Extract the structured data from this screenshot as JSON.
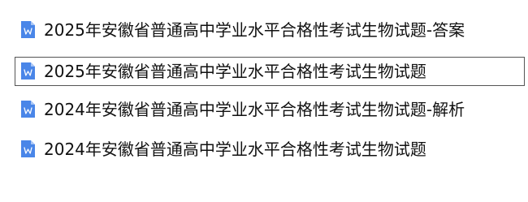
{
  "files": [
    {
      "name": "2025年安徽省普通高中学业水平合格性考试生物试题-答案",
      "icon": "word-document-icon",
      "selected": false
    },
    {
      "name": "2025年安徽省普通高中学业水平合格性考试生物试题",
      "icon": "word-document-icon",
      "selected": true
    },
    {
      "name": "2024年安徽省普通高中学业水平合格性考试生物试题-解析",
      "icon": "word-document-icon",
      "selected": false
    },
    {
      "name": "2024年安徽省普通高中学业水平合格性考试生物试题",
      "icon": "word-document-icon",
      "selected": false
    }
  ],
  "colors": {
    "icon_blue": "#4A86E8",
    "icon_fold": "#A9C6F5",
    "selection_border": "#555555",
    "text": "#111111"
  }
}
